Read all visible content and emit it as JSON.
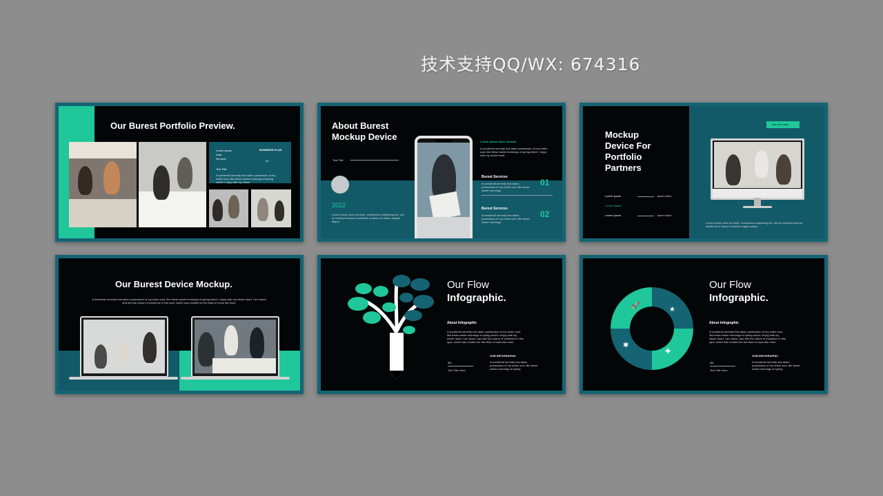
{
  "watermark": "技术支持QQ/WX: 674316",
  "colors": {
    "background": "#8d8d8d",
    "slide_border": "#156474",
    "slide_bg": "#030607",
    "accent": "#1fc79b",
    "teal": "#135a68"
  },
  "slide1": {
    "title": "Our Burest Portfolio Preview.",
    "label1": "Lorem Ipsum",
    "label2": "Date",
    "label3": "Sit amet",
    "plan": "BUSINESS PLAN",
    "num": "01",
    "text_title": "Text Title",
    "desc": "A wonderful serenity has taken possession of my entire soul, like these sweet mornings of spring which I enjoy with my whole"
  },
  "slide2": {
    "title_line1": "About Burest",
    "title_line2": "Mockup Device",
    "text_title": "Text Title",
    "year": "2022",
    "year_desc": "Lorem ipsum dolor sit amet, consectetur adipiscing elit, sed do eiusmod tempor incididunt ut labore et dolore magna aliqua.",
    "top_label": "Lorem Ipsum dolor sit amet",
    "top_desc": "A wonderful serenity has taken possession of my entire soul, like these sweet mornings of spring which I enjoy with my whole heart.",
    "service1": "Burest Services",
    "service2": "Burest Services",
    "service_desc": "A wonderful serenity has taken possession of my entire soul, like these sweet mornings",
    "num1": "01",
    "num2": "02"
  },
  "slide3": {
    "title_line1": "Mockup",
    "title_line2": "Device For",
    "title_line3": "Portfolio",
    "title_line4": "Partners",
    "button": "ADD TEXT HERE",
    "item1": "Lorem Ipsum",
    "item2": "Lorem Ipsum",
    "item3": "Lorem Ipsum",
    "item_val": "ipsum dolor",
    "desc": "Lorem ipsum dolor sit amet, consectetur adipiscing elit, sed do eiusmod tempor incididunt ut labore et dolore magna aliqua."
  },
  "slide4": {
    "title": "Our Burest Device Mockup.",
    "desc": "A wonderful serenity has taken possession of my entire soul, like these sweet mornings of spring which I enjoy with my whole heart. I am alone, and feel the charm of existence in this spot, which was created for the bliss of souls like mine."
  },
  "slide5": {
    "title_light": "Our Flow",
    "title_bold": "Infographic.",
    "about": "About Infographic",
    "desc": "A wonderful serenity has taken possession of my entire soul, like these sweet mornings of spring which I enjoy with my whole heart. I am alone, and feel the charm of existence in this spot, which was created for the bliss of souls like mine.",
    "num": "/01",
    "text_title": "Text Title Here",
    "label": "OUR INFOGRAPHIC",
    "label_desc": "A wonderful serenity has taken possession of my entire soul, like these sweet mornings of spring"
  },
  "slide6": {
    "title_light": "Our Flow",
    "title_bold": "Infographic.",
    "about": "About Infographic",
    "desc": "A wonderful serenity has taken possession of my entire soul, like these sweet mornings of spring which I enjoy with my whole heart. I am alone, and feel the charm of existence in this spot, which was created for the bliss of souls like mine.",
    "num": "/01",
    "text_title": "Text Title Here",
    "label": "OUR INFOGRAPHIC",
    "label_desc": "A wonderful serenity has taken possession of my entire soul, like these sweet mornings of spring"
  },
  "icons": {
    "rocket": "rocket-icon",
    "star": "star-icon",
    "gear": "gear-icon",
    "puzzle": "puzzle-icon"
  }
}
